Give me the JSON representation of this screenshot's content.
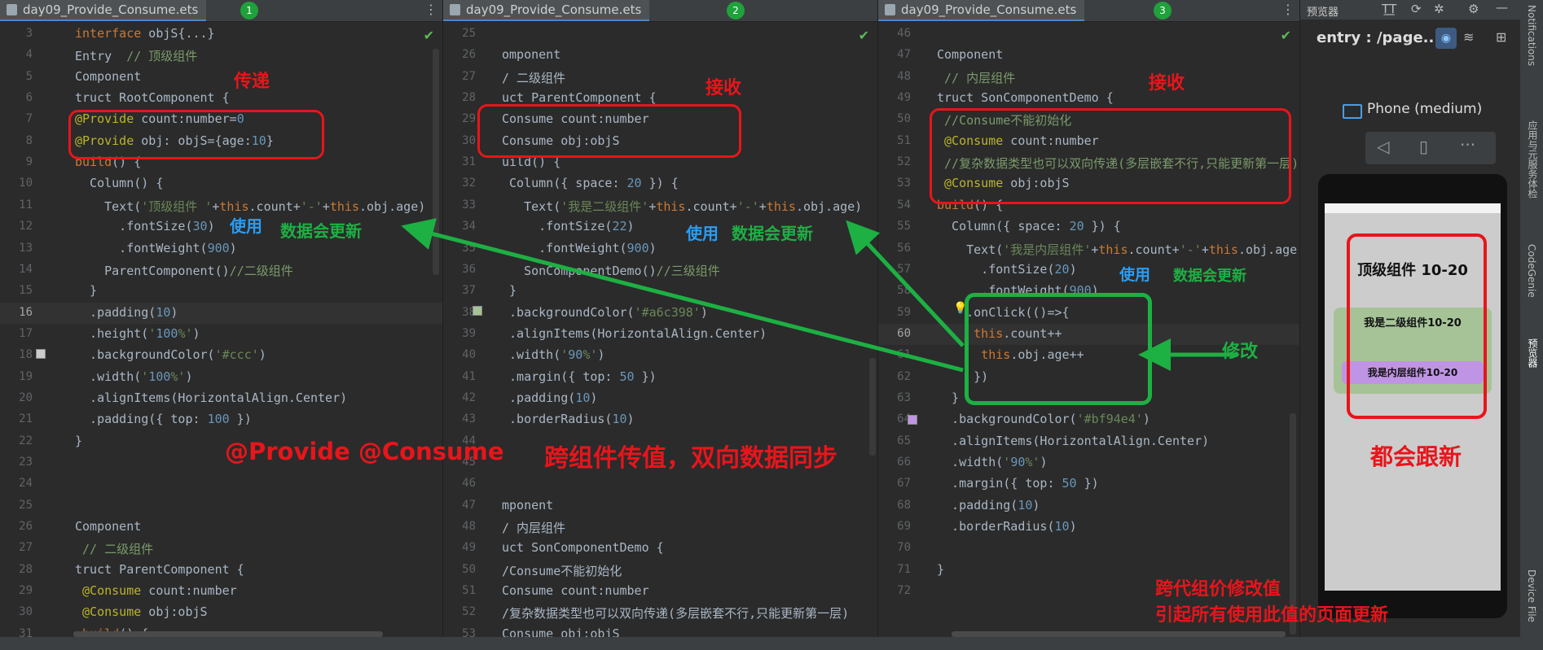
{
  "panes": [
    {
      "tab": "day09_Provide_Consume.ets",
      "badge": "1",
      "lines": [
        {
          "n": "3",
          "t": "interface objS{...}"
        },
        {
          "n": "4",
          "t": "Entry  // 顶级组件"
        },
        {
          "n": "5",
          "t": "Component"
        },
        {
          "n": "6",
          "t": "truct RootComponent {"
        },
        {
          "n": "7",
          "t": "@Provide count:number=0"
        },
        {
          "n": "8",
          "t": "@Provide obj: objS={age:10}"
        },
        {
          "n": "9",
          "t": "build() {"
        },
        {
          "n": "10",
          "t": "  Column() {"
        },
        {
          "n": "11",
          "t": "    Text('顶级组件 '+this.count+'-'+this.obj.age)"
        },
        {
          "n": "12",
          "t": "      .fontSize(30)"
        },
        {
          "n": "13",
          "t": "      .fontWeight(900)"
        },
        {
          "n": "14",
          "t": "    ParentComponent()//二级组件"
        },
        {
          "n": "15",
          "t": "  }"
        },
        {
          "n": "16",
          "t": "  .padding(10)"
        },
        {
          "n": "17",
          "t": "  .height('100%')"
        },
        {
          "n": "18",
          "t": "  .backgroundColor('#ccc')"
        },
        {
          "n": "19",
          "t": "  .width('100%')"
        },
        {
          "n": "20",
          "t": "  .alignItems(HorizontalAlign.Center)"
        },
        {
          "n": "21",
          "t": "  .padding({ top: 100 })"
        },
        {
          "n": "22",
          "t": "}"
        },
        {
          "n": "23",
          "t": ""
        },
        {
          "n": "24",
          "t": ""
        },
        {
          "n": "25",
          "t": ""
        },
        {
          "n": "26",
          "t": "Component"
        },
        {
          "n": "27",
          "t": " // 二级组件"
        },
        {
          "n": "28",
          "t": "truct ParentComponent {"
        },
        {
          "n": "29",
          "t": " @Consume count:number"
        },
        {
          "n": "30",
          "t": " @Consume obj:objS"
        },
        {
          "n": "31",
          "t": " build() {"
        }
      ]
    },
    {
      "tab": "day09_Provide_Consume.ets",
      "badge": "2",
      "lines": [
        {
          "n": "25",
          "t": ""
        },
        {
          "n": "26",
          "t": "omponent"
        },
        {
          "n": "27",
          "t": "/ 二级组件"
        },
        {
          "n": "28",
          "t": "uct ParentComponent {"
        },
        {
          "n": "29",
          "t": "Consume count:number"
        },
        {
          "n": "30",
          "t": "Consume obj:objS"
        },
        {
          "n": "31",
          "t": "uild() {"
        },
        {
          "n": "32",
          "t": " Column({ space: 20 }) {"
        },
        {
          "n": "33",
          "t": "   Text('我是二级组件'+this.count+'-'+this.obj.age)"
        },
        {
          "n": "34",
          "t": "     .fontSize(22)"
        },
        {
          "n": "35",
          "t": "     .fontWeight(900)"
        },
        {
          "n": "36",
          "t": "   SonComponentDemo()//三级组件"
        },
        {
          "n": "37",
          "t": " }"
        },
        {
          "n": "38",
          "t": " .backgroundColor('#a6c398')"
        },
        {
          "n": "39",
          "t": " .alignItems(HorizontalAlign.Center)"
        },
        {
          "n": "40",
          "t": " .width('90%')"
        },
        {
          "n": "41",
          "t": " .margin({ top: 50 })"
        },
        {
          "n": "42",
          "t": " .padding(10)"
        },
        {
          "n": "43",
          "t": " .borderRadius(10)"
        },
        {
          "n": "44",
          "t": ""
        },
        {
          "n": "45",
          "t": ""
        },
        {
          "n": "46",
          "t": ""
        },
        {
          "n": "47",
          "t": "mponent"
        },
        {
          "n": "48",
          "t": "/ 内层组件"
        },
        {
          "n": "49",
          "t": "uct SonComponentDemo {"
        },
        {
          "n": "50",
          "t": "/Consume不能初始化"
        },
        {
          "n": "51",
          "t": "Consume count:number"
        },
        {
          "n": "52",
          "t": "/复杂数据类型也可以双向传递(多层嵌套不行,只能更新第一层)"
        },
        {
          "n": "53",
          "t": "Consume obj:objS"
        }
      ]
    },
    {
      "tab": "day09_Provide_Consume.ets",
      "badge": "3",
      "lines": [
        {
          "n": "46",
          "t": ""
        },
        {
          "n": "47",
          "t": "Component"
        },
        {
          "n": "48",
          "t": " // 内层组件"
        },
        {
          "n": "49",
          "t": "truct SonComponentDemo {"
        },
        {
          "n": "50",
          "t": " //Consume不能初始化"
        },
        {
          "n": "51",
          "t": " @Consume count:number"
        },
        {
          "n": "52",
          "t": " //复杂数据类型也可以双向传递(多层嵌套不行,只能更新第一层)"
        },
        {
          "n": "53",
          "t": " @Consume obj:objS"
        },
        {
          "n": "54",
          "t": "build() {"
        },
        {
          "n": "55",
          "t": "  Column({ space: 20 }) {"
        },
        {
          "n": "56",
          "t": "    Text('我是内层组件'+this.count+'-'+this.obj.age"
        },
        {
          "n": "57",
          "t": "      .fontSize(20)"
        },
        {
          "n": "58",
          "t": "      .fontWeight(900)"
        },
        {
          "n": "59",
          "t": "    .onClick(()=>{"
        },
        {
          "n": "60",
          "t": "     this.count++"
        },
        {
          "n": "61",
          "t": "      this.obj.age++"
        },
        {
          "n": "62",
          "t": "     })"
        },
        {
          "n": "63",
          "t": "  }"
        },
        {
          "n": "64",
          "t": "  .backgroundColor('#bf94e4')"
        },
        {
          "n": "65",
          "t": "  .alignItems(HorizontalAlign.Center)"
        },
        {
          "n": "66",
          "t": "  .width('90%')"
        },
        {
          "n": "67",
          "t": "  .margin({ top: 50 })"
        },
        {
          "n": "68",
          "t": "  .padding(10)"
        },
        {
          "n": "69",
          "t": "  .borderRadius(10)"
        },
        {
          "n": "70",
          "t": ""
        },
        {
          "n": "71",
          "t": "}"
        },
        {
          "n": "72",
          "t": ""
        }
      ]
    }
  ],
  "annotations": {
    "pass": "传递",
    "receive1": "接收",
    "receive2": "接收",
    "use1": "使用",
    "update1": "数据会更新",
    "use2": "使用",
    "update2": "数据会更新",
    "use3": "使用",
    "update3": "数据会更新",
    "modify": "修改",
    "decorators": "@Provide  @Consume",
    "headline": "跨组件传值，双向数据同步",
    "all_update": "都会跟新",
    "footer1": "跨代组价修改值",
    "footer2": "引起所有使用此值的页面更新"
  },
  "preview": {
    "title": "预览器",
    "path": "entry : /page...",
    "device": "Phone (medium)",
    "top_text": "顶级组件 10-20",
    "second_text": "我是二级组件10-20",
    "inner_text": "我是内层组件10-20",
    "colors": {
      "bg": "#cccccc",
      "second": "#a6c398",
      "inner": "#bf94e4"
    }
  },
  "side_tools": [
    "Notifications",
    "应用与元服务体检",
    "CodeGenie",
    "预览器",
    "Device File"
  ],
  "colors": {
    "red": "#e8151b",
    "green": "#1db043",
    "blue": "#2a9df4"
  }
}
